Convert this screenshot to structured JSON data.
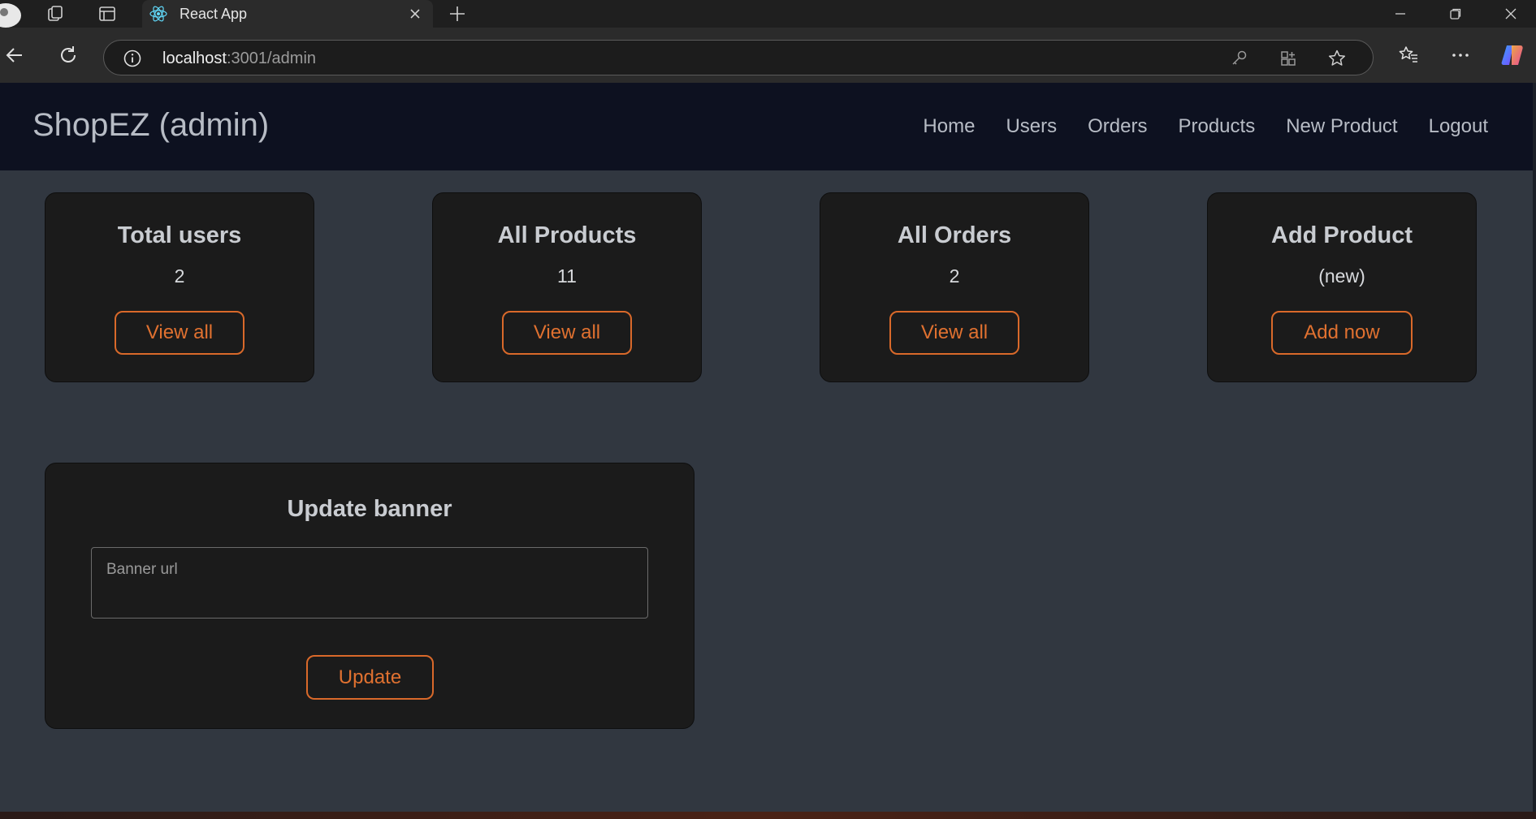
{
  "browser": {
    "tab_title": "React App",
    "url_host": "localhost",
    "url_path": ":3001/admin"
  },
  "navbar": {
    "brand": "ShopEZ (admin)",
    "links": [
      "Home",
      "Users",
      "Orders",
      "Products",
      "New Product",
      "Logout"
    ]
  },
  "cards": [
    {
      "title": "Total users",
      "value": "2",
      "button": "View all"
    },
    {
      "title": "All Products",
      "value": "11",
      "button": "View all"
    },
    {
      "title": "All Orders",
      "value": "2",
      "button": "View all"
    },
    {
      "title": "Add Product",
      "value": "(new)",
      "button": "Add now"
    }
  ],
  "banner": {
    "title": "Update banner",
    "input_placeholder": "Banner url",
    "button": "Update"
  },
  "colors": {
    "accent": "#e07130",
    "navbar_bg": "#0d1120",
    "page_bg": "#313740",
    "card_bg": "#1b1b1b"
  }
}
